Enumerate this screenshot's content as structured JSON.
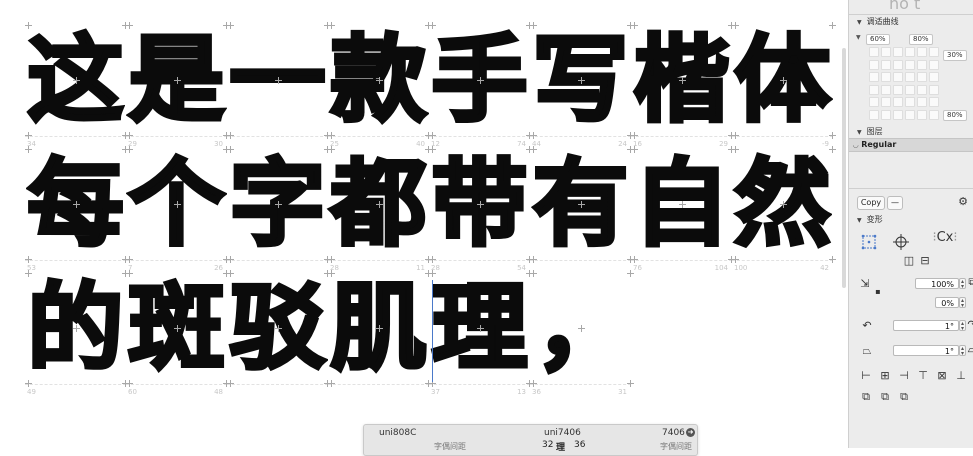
{
  "canvas": {
    "rows": [
      {
        "glyphs": [
          {
            "char": "这",
            "lsb": "34",
            "rsb": ""
          },
          {
            "char": "是",
            "lsb": "29",
            "rsb": "30"
          },
          {
            "char": "一",
            "lsb": "",
            "rsb": ""
          },
          {
            "char": "款",
            "lsb": "25",
            "rsb": "40"
          },
          {
            "char": "手",
            "lsb": "12",
            "rsb": "74"
          },
          {
            "char": "写",
            "lsb": "44",
            "rsb": "24"
          },
          {
            "char": "楷",
            "lsb": "16",
            "rsb": "29"
          },
          {
            "char": "体",
            "lsb": "",
            "rsb": "-9"
          }
        ]
      },
      {
        "glyphs": [
          {
            "char": "每",
            "lsb": "53",
            "rsb": ""
          },
          {
            "char": "个",
            "lsb": "7",
            "rsb": "26"
          },
          {
            "char": "字",
            "lsb": "",
            "rsb": ""
          },
          {
            "char": "都",
            "lsb": "28",
            "rsb": "11"
          },
          {
            "char": "带",
            "lsb": "28",
            "rsb": "54"
          },
          {
            "char": "有",
            "lsb": "",
            "rsb": ""
          },
          {
            "char": "自",
            "lsb": "76",
            "rsb": "104"
          },
          {
            "char": "然",
            "lsb": "100",
            "rsb": "42"
          }
        ]
      },
      {
        "glyphs": [
          {
            "char": "的",
            "lsb": "49",
            "rsb": ""
          },
          {
            "char": "斑",
            "lsb": "60",
            "rsb": "48"
          },
          {
            "char": "驳",
            "lsb": "",
            "rsb": ""
          },
          {
            "char": "肌",
            "lsb": "",
            "rsb": ""
          },
          {
            "char": "理",
            "lsb": "37",
            "rsb": "13"
          },
          {
            "char": "，",
            "lsb": "36",
            "rsb": "31"
          }
        ]
      }
    ]
  },
  "popup": {
    "left_name": "uni808C",
    "mid_name": "uni7406",
    "right_value": "7406",
    "left_sub": "字偶间距",
    "right_sub": "字偶间距",
    "metric_left": "32",
    "metric_right": "36"
  },
  "sidebar": {
    "top_clipped_title": "no t",
    "curve_section": "调适曲线",
    "curve_values": [
      "60%",
      "80%",
      "30%",
      "80%"
    ],
    "layers_section": "图层",
    "layer_name": "Regular",
    "copy_label": "Copy",
    "minus_label": "—",
    "transform_section": "变形",
    "cx_label": "Cx",
    "scale_value": "100%",
    "offset_value": "0%",
    "rotate_value": "1°",
    "slant_value": "1°"
  }
}
